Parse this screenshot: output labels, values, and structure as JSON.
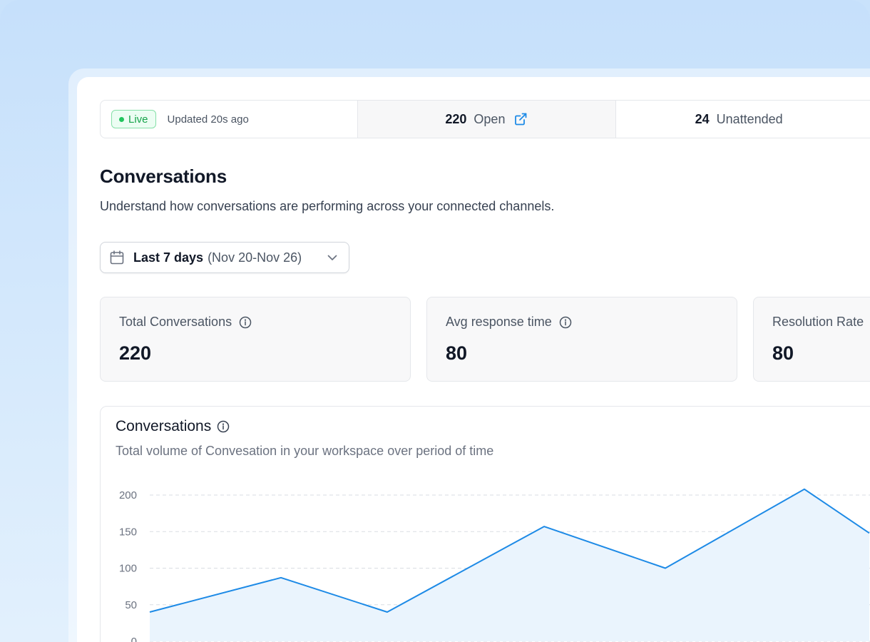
{
  "status_bar": {
    "live_label": "Live",
    "updated_text": "Updated 20s ago",
    "open_count": "220",
    "open_label": "Open",
    "unattended_count": "24",
    "unattended_label": "Unattended"
  },
  "page": {
    "title": "Conversations",
    "subtitle": "Understand how conversations are performing across your connected channels."
  },
  "date_filter": {
    "label": "Last 7 days",
    "range": "(Nov 20-Nov 26)"
  },
  "stats": [
    {
      "label": "Total Conversations",
      "value": "220"
    },
    {
      "label": "Avg response time",
      "value": "80"
    },
    {
      "label": "Resolution Rate",
      "value": "80"
    }
  ],
  "chart_card": {
    "title": "Conversations",
    "subtitle": "Total volume of Convesation in your workspace over period of time"
  },
  "chart_data": {
    "type": "area",
    "title": "Conversations",
    "subtitle": "Total volume of Convesation in your workspace over period of time",
    "y_ticks": [
      "200",
      "150",
      "100",
      "50",
      "0"
    ],
    "ylim": [
      0,
      200
    ],
    "series": [
      {
        "values": [
          40,
          87,
          40,
          157,
          100,
          208,
          148
        ]
      }
    ],
    "grid": true,
    "colors": {
      "line": "#1d8ae6",
      "fill": "#eaf4fd"
    }
  },
  "colors": {
    "accent": "#1d8ae6",
    "live_green": "#16a34a",
    "background": "#c9e2fb"
  },
  "icons": {
    "external_link": "external-link-icon",
    "calendar": "calendar-icon",
    "chevron": "chevron-down-icon",
    "info": "info-icon"
  }
}
